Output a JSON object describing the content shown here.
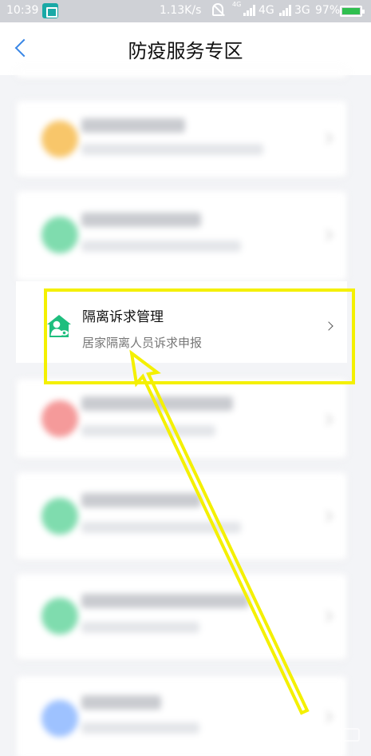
{
  "status_bar": {
    "time": "10:39",
    "net_speed": "1.13K/s",
    "network_1": "4G",
    "network_2": "4G",
    "network_3": "3G",
    "battery": "97%",
    "icons": [
      "screenshot-icon",
      "mute-bell-icon",
      "signal-icon",
      "battery-icon"
    ]
  },
  "header": {
    "title": "防疫服务专区",
    "back_icon": "chevron-left-icon"
  },
  "focused_item": {
    "title": "隔离诉求管理",
    "subtitle": "居家隔离人员诉求申报",
    "icon": "home-person-icon",
    "chevron": "chevron-right-icon"
  },
  "blurred_list": {
    "dot_colors": [
      "#f8c66a",
      "#7fdcae",
      "#f59a9a",
      "#7fdcae",
      "#7fdcae",
      "#9ec2ff"
    ]
  },
  "annotation": {
    "highlight_color": "#f4f000"
  },
  "colors": {
    "accent": "#3a87e6",
    "icon_green": "#1fbe7e"
  }
}
